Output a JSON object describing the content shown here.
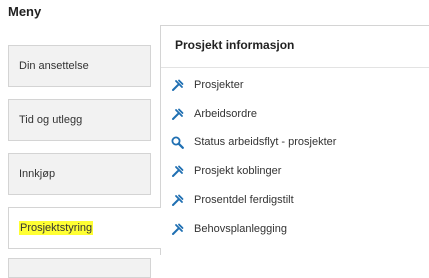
{
  "page": {
    "title": "Meny"
  },
  "sidebar": {
    "items": [
      {
        "label": "Din ansettelse"
      },
      {
        "label": "Tid og utlegg"
      },
      {
        "label": "Innkjøp"
      },
      {
        "label": "Prosjektstyring",
        "active": true
      }
    ]
  },
  "panel": {
    "title": "Prosjekt informasjon",
    "links": [
      {
        "label": "Prosjekter",
        "icon": "tools-icon"
      },
      {
        "label": "Arbeidsordre",
        "icon": "tools-icon"
      },
      {
        "label": "Status arbeidsflyt - prosjekter",
        "icon": "search-icon"
      },
      {
        "label": "Prosjekt koblinger",
        "icon": "tools-icon"
      },
      {
        "label": "Prosentdel ferdigstilt",
        "icon": "tools-icon"
      },
      {
        "label": "Behovsplanlegging",
        "icon": "tools-icon"
      }
    ]
  },
  "colors": {
    "icon": "#1f6fb2",
    "highlight": "#ffff33"
  }
}
